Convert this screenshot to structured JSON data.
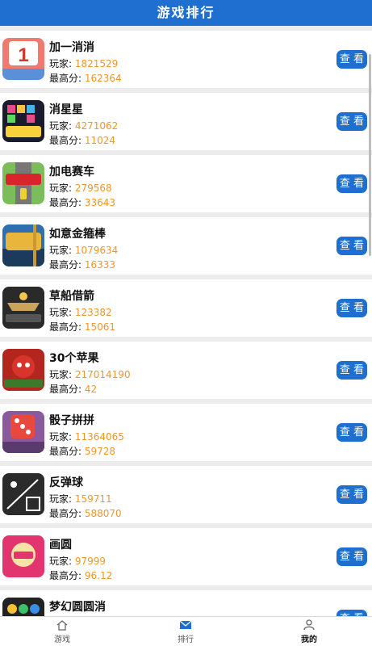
{
  "header": {
    "title": "游戏排行"
  },
  "labels": {
    "players": "玩家: ",
    "high_score": "最高分: ",
    "view_button": "查 看"
  },
  "games": [
    {
      "name": "加一消消",
      "players": "1821529",
      "high_score": "162364",
      "thumb_text": "加一消消"
    },
    {
      "name": "消星星",
      "players": "4271062",
      "high_score": "11024",
      "thumb_text": "消星星"
    },
    {
      "name": "加电赛车",
      "players": "279568",
      "high_score": "33643",
      "thumb_text": "加电赛车"
    },
    {
      "name": "如意金箍棒",
      "players": "1079634",
      "high_score": "16333",
      "thumb_text": "如意金箍棒"
    },
    {
      "name": "草船借箭",
      "players": "123382",
      "high_score": "15061",
      "thumb_text": "草船借箭"
    },
    {
      "name": "30个苹果",
      "players": "217014190",
      "high_score": "42",
      "thumb_text": "30个苹果"
    },
    {
      "name": "骰子拼拼",
      "players": "11364065",
      "high_score": "59728",
      "thumb_text": "骰子拼拼"
    },
    {
      "name": "反弹球",
      "players": "159711",
      "high_score": "588070",
      "thumb_text": "反弹球"
    },
    {
      "name": "画圆",
      "players": "97999",
      "high_score": "96.12",
      "thumb_text": "画圆"
    },
    {
      "name": "梦幻圆圆消",
      "players": "",
      "high_score": "",
      "thumb_text": ""
    }
  ],
  "tabbar": [
    {
      "label": "游戏",
      "icon": "home-icon"
    },
    {
      "label": "排行",
      "icon": "mail-icon"
    },
    {
      "label": "我的",
      "icon": "user-icon"
    }
  ],
  "colors": {
    "accent": "#1e6fd0",
    "value": "#f0962b",
    "background": "#ececec"
  }
}
